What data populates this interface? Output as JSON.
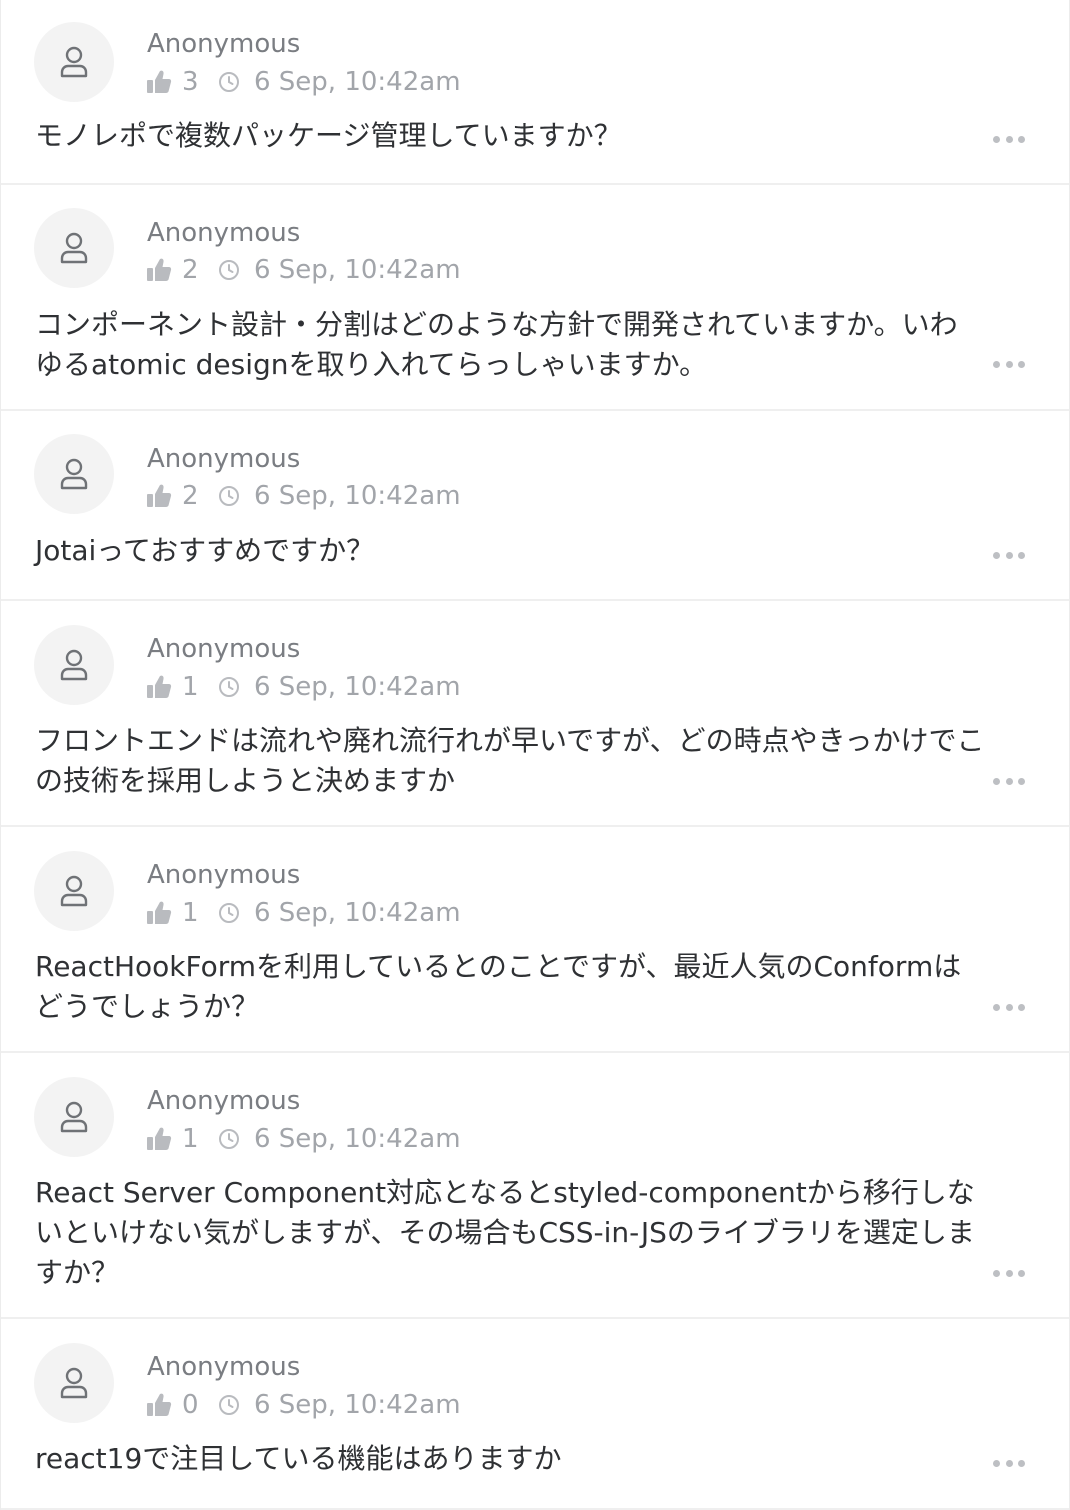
{
  "questions": [
    {
      "author": "Anonymous",
      "likes": "3",
      "time": "6 Sep, 10:42am",
      "text": "モノレポで複数パッケージ管理していますか？"
    },
    {
      "author": "Anonymous",
      "likes": "2",
      "time": "6 Sep, 10:42am",
      "text": "コンポーネント設計・分割はどのような方針で開発されていますか。いわゆるatomic designを取り入れてらっしゃいますか。"
    },
    {
      "author": "Anonymous",
      "likes": "2",
      "time": "6 Sep, 10:42am",
      "text": "Jotaiっておすすめですか？"
    },
    {
      "author": "Anonymous",
      "likes": "1",
      "time": "6 Sep, 10:42am",
      "text": "フロントエンドは流れや廃れ流行れが早いですが、どの時点やきっかけでこの技術を採用しようと決めますか"
    },
    {
      "author": "Anonymous",
      "likes": "1",
      "time": "6 Sep, 10:42am",
      "text": "ReactHookFormを利用しているとのことですが、最近人気のConformはどうでしょうか？"
    },
    {
      "author": "Anonymous",
      "likes": "1",
      "time": "6 Sep, 10:42am",
      "text": "React Server Component対応となるとstyled-componentから移行しないといけない気がしますが、その場合もCSS-in-JSのライブラリを選定しますか？"
    },
    {
      "author": "Anonymous",
      "likes": "0",
      "time": "6 Sep, 10:42am",
      "text": "react19で注目している機能はありますか"
    }
  ],
  "icons": {
    "avatar": "person-icon",
    "like": "thumbs-up-icon",
    "time": "clock-icon",
    "menu": "more-options-icon"
  },
  "colors": {
    "background": "#ffffff",
    "divider": "#efefef",
    "avatar_bg": "#f3f3f3",
    "author_text": "#7a7d82",
    "meta_text": "#a2a5aa",
    "question_text": "#2f3134",
    "icon": "#b9bbbf"
  }
}
